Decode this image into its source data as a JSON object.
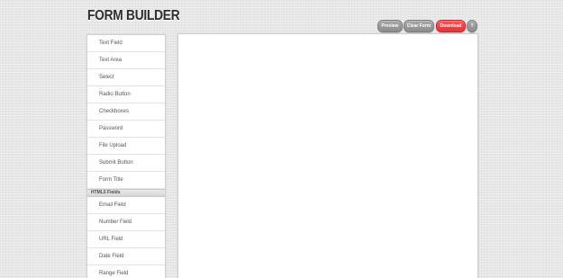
{
  "header": {
    "title": "FORM BUILDER"
  },
  "toolbar": {
    "preview_label": "Preview",
    "clear_label": "Clear Form",
    "download_label": "Download",
    "help_label": "?"
  },
  "sidebar": {
    "items": [
      {
        "label": "Text Field"
      },
      {
        "label": "Text Area"
      },
      {
        "label": "Select"
      },
      {
        "label": "Radio Button"
      },
      {
        "label": "Checkboxes"
      },
      {
        "label": "Password"
      },
      {
        "label": "File Upload"
      },
      {
        "label": "Submit Button"
      },
      {
        "label": "Form Title"
      }
    ],
    "html5_section": {
      "title": "HTML5 Fields",
      "items": [
        {
          "label": "Email Field"
        },
        {
          "label": "Number Field"
        },
        {
          "label": "URL Field"
        },
        {
          "label": "Date Field"
        },
        {
          "label": "Range Field"
        }
      ]
    }
  },
  "colors": {
    "background": "#e6e6e6",
    "button_gray": "#9a9a9a",
    "button_red": "#e8444a",
    "panel": "#ffffff"
  }
}
